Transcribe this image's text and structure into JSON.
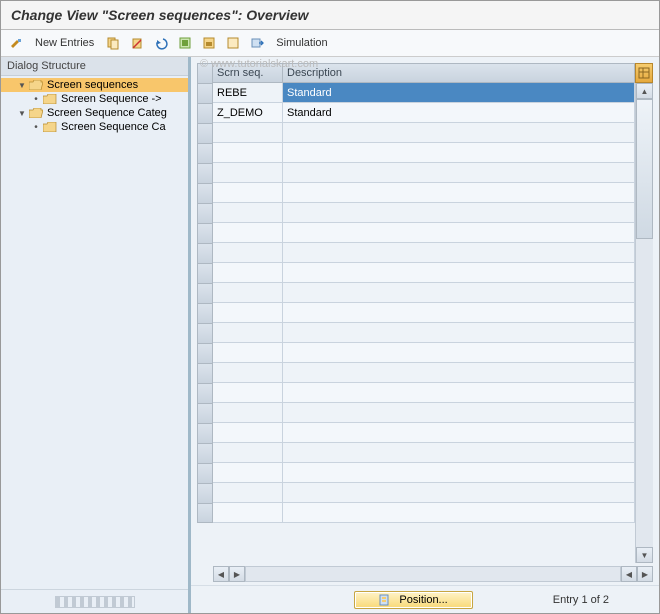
{
  "title": "Change View \"Screen sequences\": Overview",
  "toolbar": {
    "new_entries": "New Entries",
    "simulation": "Simulation"
  },
  "left": {
    "header": "Dialog Structure",
    "items": [
      {
        "label": "Screen sequences",
        "indent": 1,
        "toggle": "▾",
        "open": true,
        "selected": true
      },
      {
        "label": "Screen Sequence ->",
        "indent": 2,
        "toggle": "•",
        "open": false,
        "selected": false
      },
      {
        "label": "Screen Sequence Categ",
        "indent": 1,
        "toggle": "▾",
        "open": true,
        "selected": false
      },
      {
        "label": "Screen Sequence Ca",
        "indent": 2,
        "toggle": "•",
        "open": false,
        "selected": false
      }
    ]
  },
  "grid": {
    "columns": [
      {
        "key": "seq",
        "label": "Scrn seq."
      },
      {
        "key": "desc",
        "label": "Description"
      }
    ],
    "rows": [
      {
        "seq": "REBE",
        "desc": "Standard",
        "selected": true
      },
      {
        "seq": "Z_DEMO",
        "desc": "Standard",
        "selected": false
      }
    ],
    "empty_rows": 20
  },
  "footer": {
    "position_label": "Position...",
    "entry_text": "Entry 1 of 2"
  },
  "watermark": "© www.tutorialskart.com"
}
